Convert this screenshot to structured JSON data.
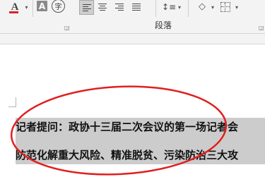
{
  "ribbon": {
    "font_color_label": "A",
    "clear_format_label": "A",
    "phonetic_label": "字",
    "paragraph_group_label": "段落",
    "icons": [
      "font-color-icon",
      "clear-formatting-icon",
      "phonetic-guide-icon",
      "align-left-icon",
      "align-center-icon",
      "align-right-icon",
      "justify-icon",
      "line-spacing-icon",
      "shading-icon",
      "borders-icon"
    ],
    "font_color": "#d22222"
  },
  "document": {
    "line1": "记者提问：政协十三届二次会议的第一场记者会",
    "line2": "防范化解重大风险、精准脱贫、污染防治三大攻"
  },
  "annotation": {
    "color": "#e02020",
    "shape": "ellipse"
  }
}
